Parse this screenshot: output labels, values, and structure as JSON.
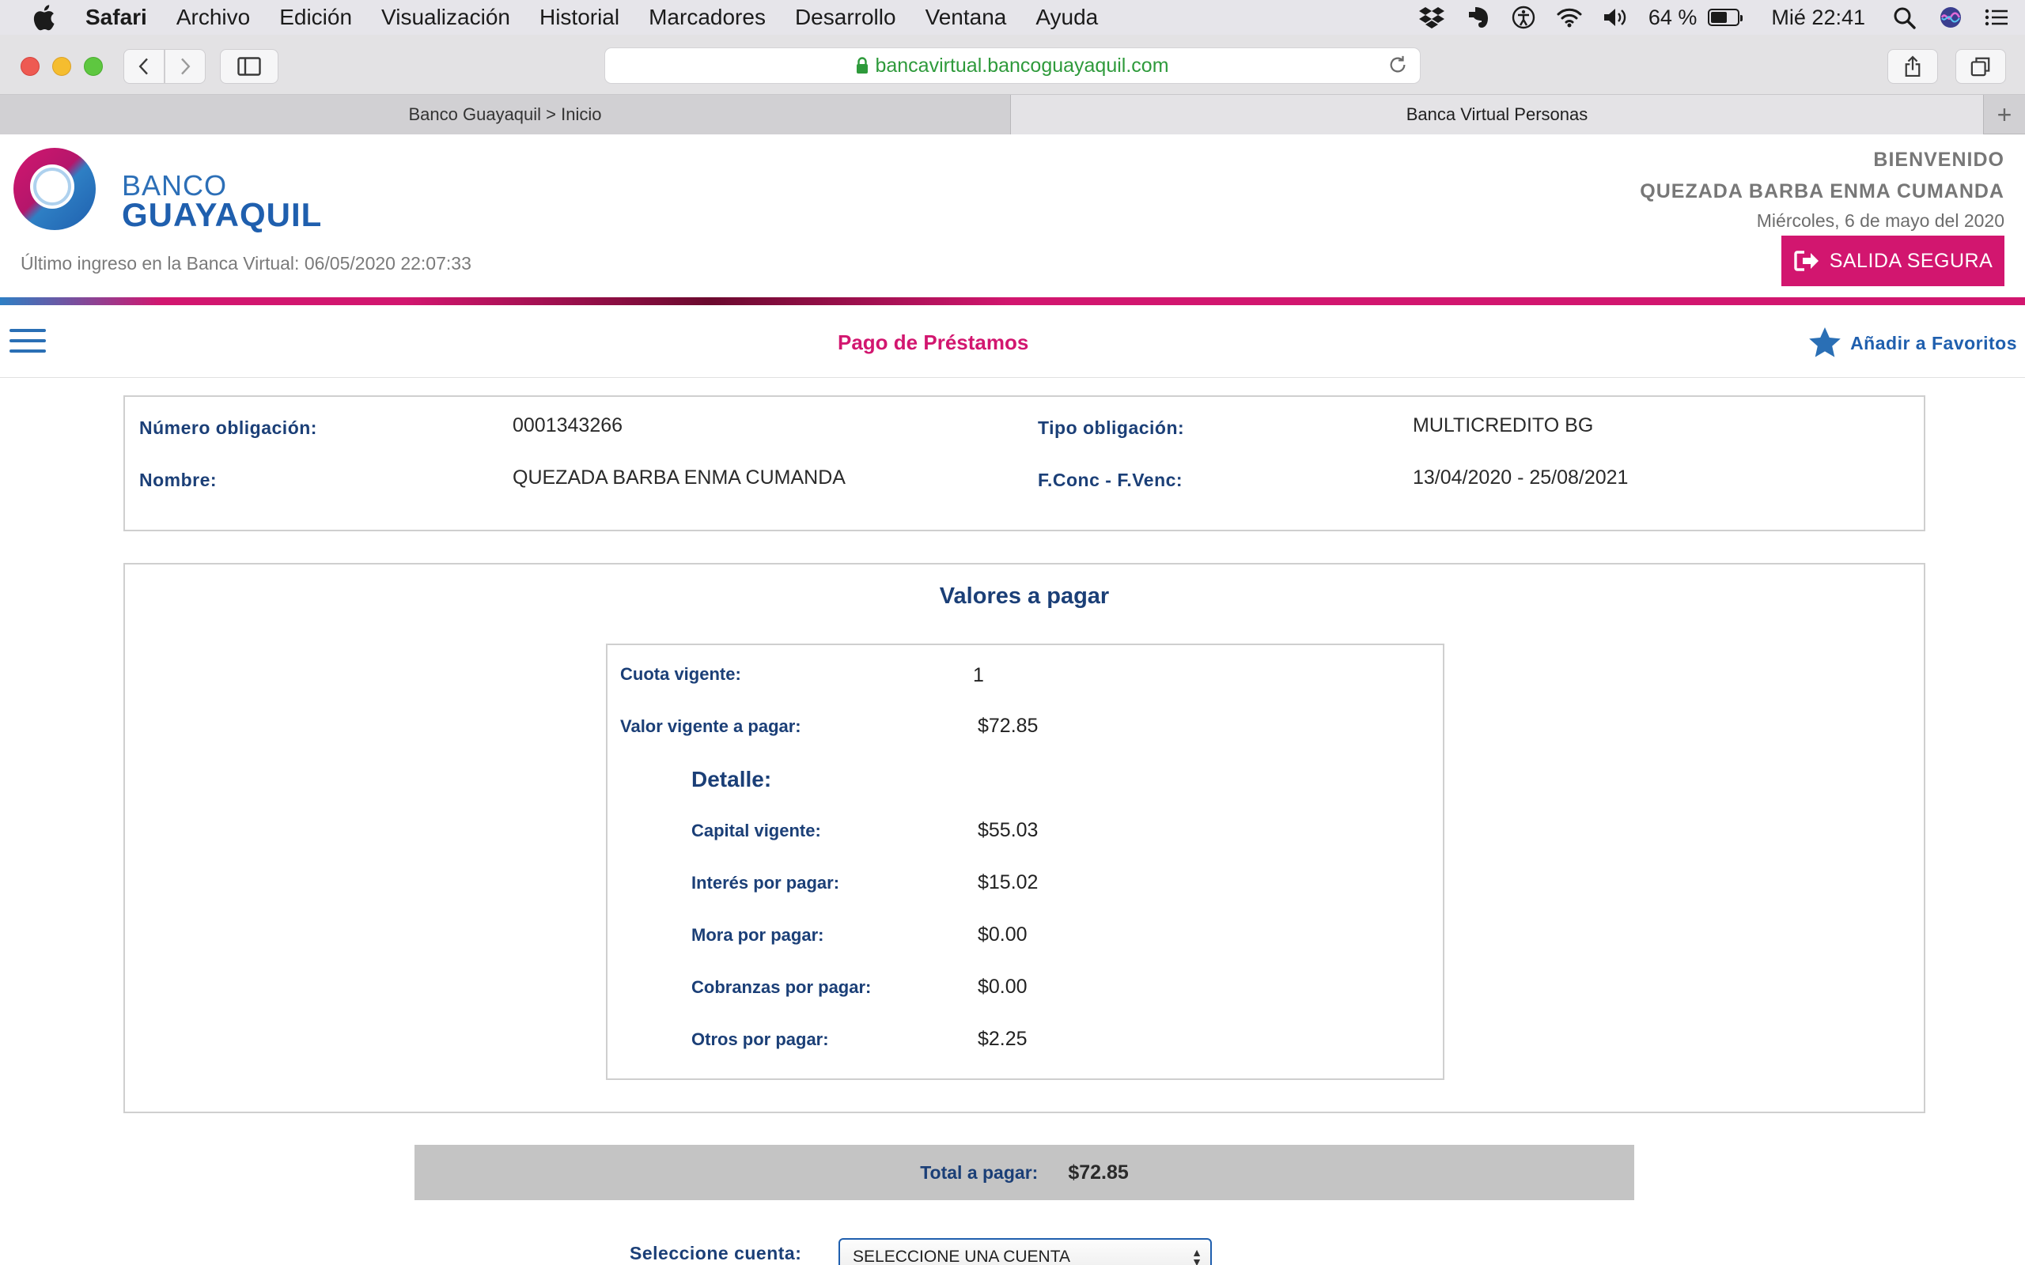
{
  "menubar": {
    "app_name": "Safari",
    "items": [
      "Archivo",
      "Edición",
      "Visualización",
      "Historial",
      "Marcadores",
      "Desarrollo",
      "Ventana",
      "Ayuda"
    ],
    "battery_text": "64 %",
    "battery_level": 0.64,
    "clock": "Mié 22:41",
    "status_icons": [
      "dropbox-icon",
      "evernote-icon",
      "accessibility-icon",
      "wifi-icon",
      "volume-icon",
      "battery-icon",
      "spotlight-icon",
      "siri-icon",
      "notification-center-icon"
    ]
  },
  "browser": {
    "url": "bancavirtual.bancoguayaquil.com",
    "tabs": [
      {
        "label": "Banco Guayaquil > Inicio",
        "active": false
      },
      {
        "label": "Banca Virtual Personas",
        "active": true
      }
    ],
    "new_tab_label": "+"
  },
  "bank": {
    "logo_line1": "BANCO",
    "logo_line2": "GUAYAQUIL",
    "last_login_label": "Último ingreso en la Banca Virtual:",
    "last_login_value": "06/05/2020 22:07:33",
    "welcome": "BIENVENIDO",
    "user_name": "QUEZADA BARBA ENMA CUMANDA",
    "date": "Miércoles, 6 de mayo del 2020",
    "exit_label": "SALIDA SEGURA",
    "brand_color": "#d2166f",
    "brand_blue": "#1f5fae"
  },
  "page": {
    "title": "Pago de Préstamos",
    "favorites_label": "Añadir a Favoritos"
  },
  "obligation": {
    "numero_label": "Número obligación:",
    "numero_value": "0001343266",
    "tipo_label": "Tipo obligación:",
    "tipo_value": "MULTICREDITO BG",
    "nombre_label": "Nombre:",
    "nombre_value": "QUEZADA BARBA ENMA CUMANDA",
    "fechas_label": "F.Conc - F.Venc:",
    "fechas_value": "13/04/2020 - 25/08/2021"
  },
  "values": {
    "title": "Valores a pagar",
    "cuota_label": "Cuota vigente:",
    "cuota_value": "1",
    "valor_label": "Valor vigente a pagar:",
    "valor_value": "$72.85",
    "detalle_label": "Detalle:",
    "details": [
      {
        "label": "Capital vigente:",
        "value": "$55.03"
      },
      {
        "label": "Interés por pagar:",
        "value": "$15.02"
      },
      {
        "label": "Mora por pagar:",
        "value": "$0.00"
      },
      {
        "label": "Cobranzas por pagar:",
        "value": "$0.00"
      },
      {
        "label": "Otros por pagar:",
        "value": "$2.25"
      }
    ]
  },
  "total": {
    "label": "Total a pagar:",
    "value": "$72.85"
  },
  "account": {
    "label": "Seleccione cuenta:",
    "selected": "SELECCIONE UNA CUENTA"
  }
}
